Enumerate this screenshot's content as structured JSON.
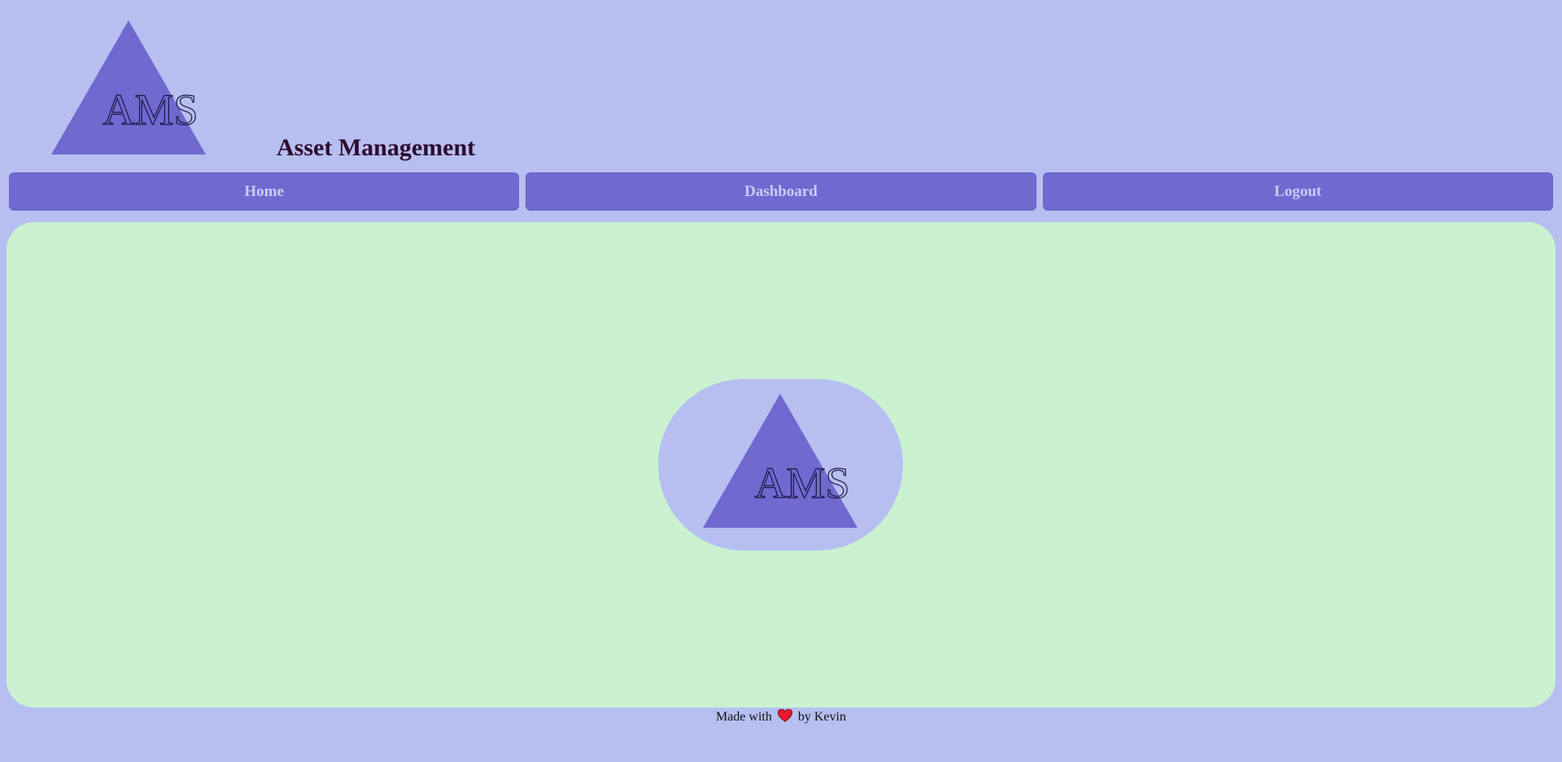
{
  "header": {
    "logo_text": "AMS",
    "title": "Asset Management"
  },
  "nav": {
    "items": [
      {
        "label": "Home"
      },
      {
        "label": "Dashboard"
      },
      {
        "label": "Logout"
      }
    ]
  },
  "main": {
    "badge_logo_text": "AMS"
  },
  "footer": {
    "prefix": "Made with",
    "icon": "heart-icon",
    "suffix": "by Kevin"
  },
  "colors": {
    "page_background": "#b7bff0",
    "logo_triangle": "#7069d0",
    "nav_button": "#7069d0",
    "nav_text": "#c9cdf5",
    "main_panel": "#caf2d1",
    "title_text": "#2d0b2e",
    "heart": "#e8192c"
  }
}
